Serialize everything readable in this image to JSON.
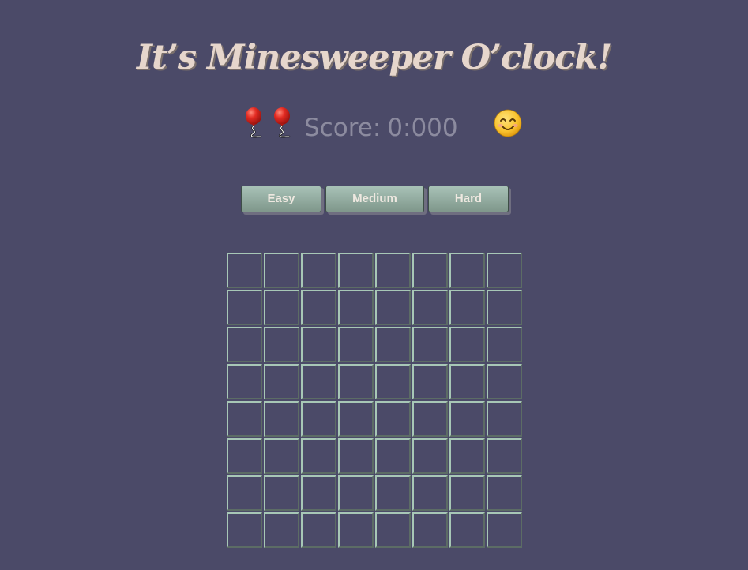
{
  "header": {
    "title": "It’s Minesweeper O’clock!"
  },
  "status": {
    "lives_icons": [
      "balloon-icon",
      "balloon-icon"
    ],
    "lives": 2,
    "score_label": "Score:",
    "score_value": "0:000",
    "face_icon": "smiling-face-icon"
  },
  "difficulty": {
    "buttons": [
      {
        "label": "Easy"
      },
      {
        "label": "Medium"
      },
      {
        "label": "Hard"
      }
    ]
  },
  "board": {
    "rows": 8,
    "cols": 8,
    "cell_state": "hidden"
  },
  "colors": {
    "background": "#4b4a68",
    "title": "#e6d6cc",
    "button": "#93ada1",
    "cell_border_light": "#a7c7b6",
    "score_text": "#8c8b9f"
  }
}
